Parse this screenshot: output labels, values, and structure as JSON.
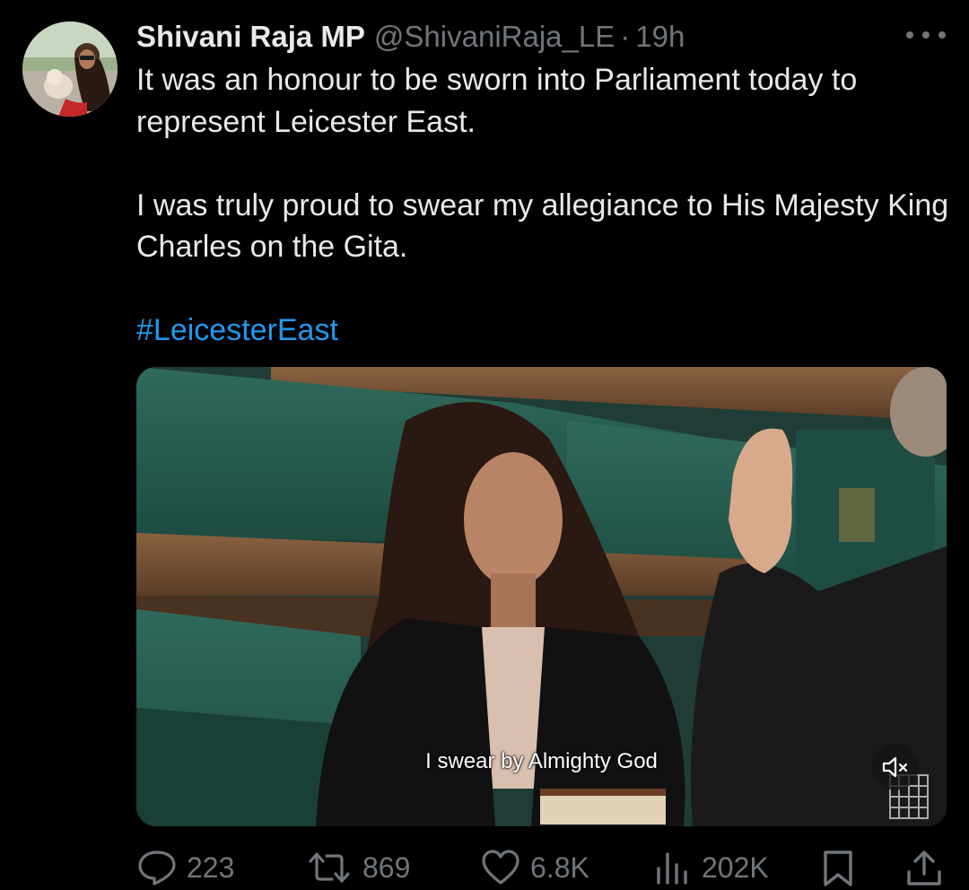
{
  "tweet": {
    "author": {
      "name": "Shivani Raja MP",
      "handle": "@ShivaniRaja_LE",
      "separator": "·",
      "time": "19h"
    },
    "text": {
      "line1": "It was an honour to be sworn into Parliament today to represent Leicester East.",
      "line2": "I was truly proud to swear my allegiance to His Majesty King Charles on the Gita.",
      "hashtag": "#LeicesterEast"
    },
    "video": {
      "caption": "I swear by Almighty God",
      "muted": true
    },
    "actions": {
      "replies": "223",
      "reposts": "869",
      "likes": "6.8K",
      "views": "202K"
    }
  },
  "colors": {
    "background": "#000000",
    "text": "#e7e9ea",
    "secondary": "#71767b",
    "link": "#1d9bf0"
  },
  "icons": {
    "more": "more-horizontal-icon",
    "reply": "reply-icon",
    "repost": "repost-icon",
    "like": "heart-icon",
    "views": "views-icon",
    "bookmark": "bookmark-icon",
    "share": "share-icon",
    "mute": "volume-muted-icon"
  }
}
